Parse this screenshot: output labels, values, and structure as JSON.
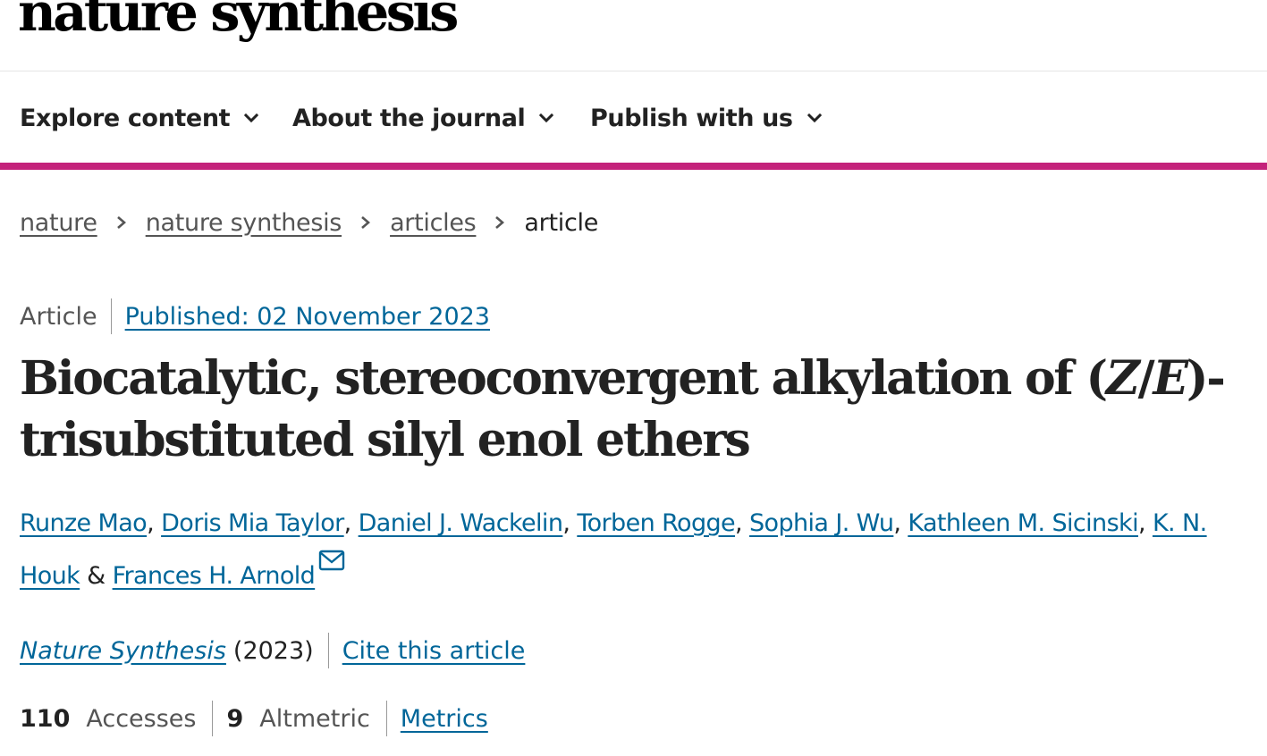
{
  "header": {
    "logo_text": "nature synthesis"
  },
  "nav": {
    "items": [
      {
        "label": "Explore content",
        "icon": "chevron-down-icon"
      },
      {
        "label": "About the journal",
        "icon": "chevron-down-icon"
      },
      {
        "label": "Publish with us",
        "icon": "chevron-down-icon"
      }
    ],
    "accent_color": "#c4227b"
  },
  "breadcrumb": {
    "items": [
      "nature",
      "nature synthesis",
      "articles",
      "article"
    ]
  },
  "article": {
    "type": "Article",
    "published": "Published: 02 November 2023",
    "title_part1": "Biocatalytic, stereoconvergent alkylation of (",
    "title_z": "Z",
    "title_slash": "/",
    "title_e": "E",
    "title_part2": ")-trisubstituted silyl enol ethers",
    "authors": [
      "Runze Mao",
      "Doris Mia Taylor",
      "Daniel J. Wackelin",
      "Torben Rogge",
      "Sophia J. Wu",
      "Kathleen M. Sicinski",
      "K. N. Houk",
      "Frances H. Arnold"
    ],
    "author_separator": ", ",
    "last_separator": " & ",
    "journal": "Nature Synthesis",
    "year": "(2023)",
    "cite_label": "Cite this article"
  },
  "metrics": {
    "accesses_count": "110",
    "accesses_label": "Accesses",
    "altmetric_count": "9",
    "altmetric_label": "Altmetric",
    "metrics_link": "Metrics"
  },
  "colors": {
    "link": "#006699",
    "text": "#222222",
    "muted": "#555555"
  }
}
